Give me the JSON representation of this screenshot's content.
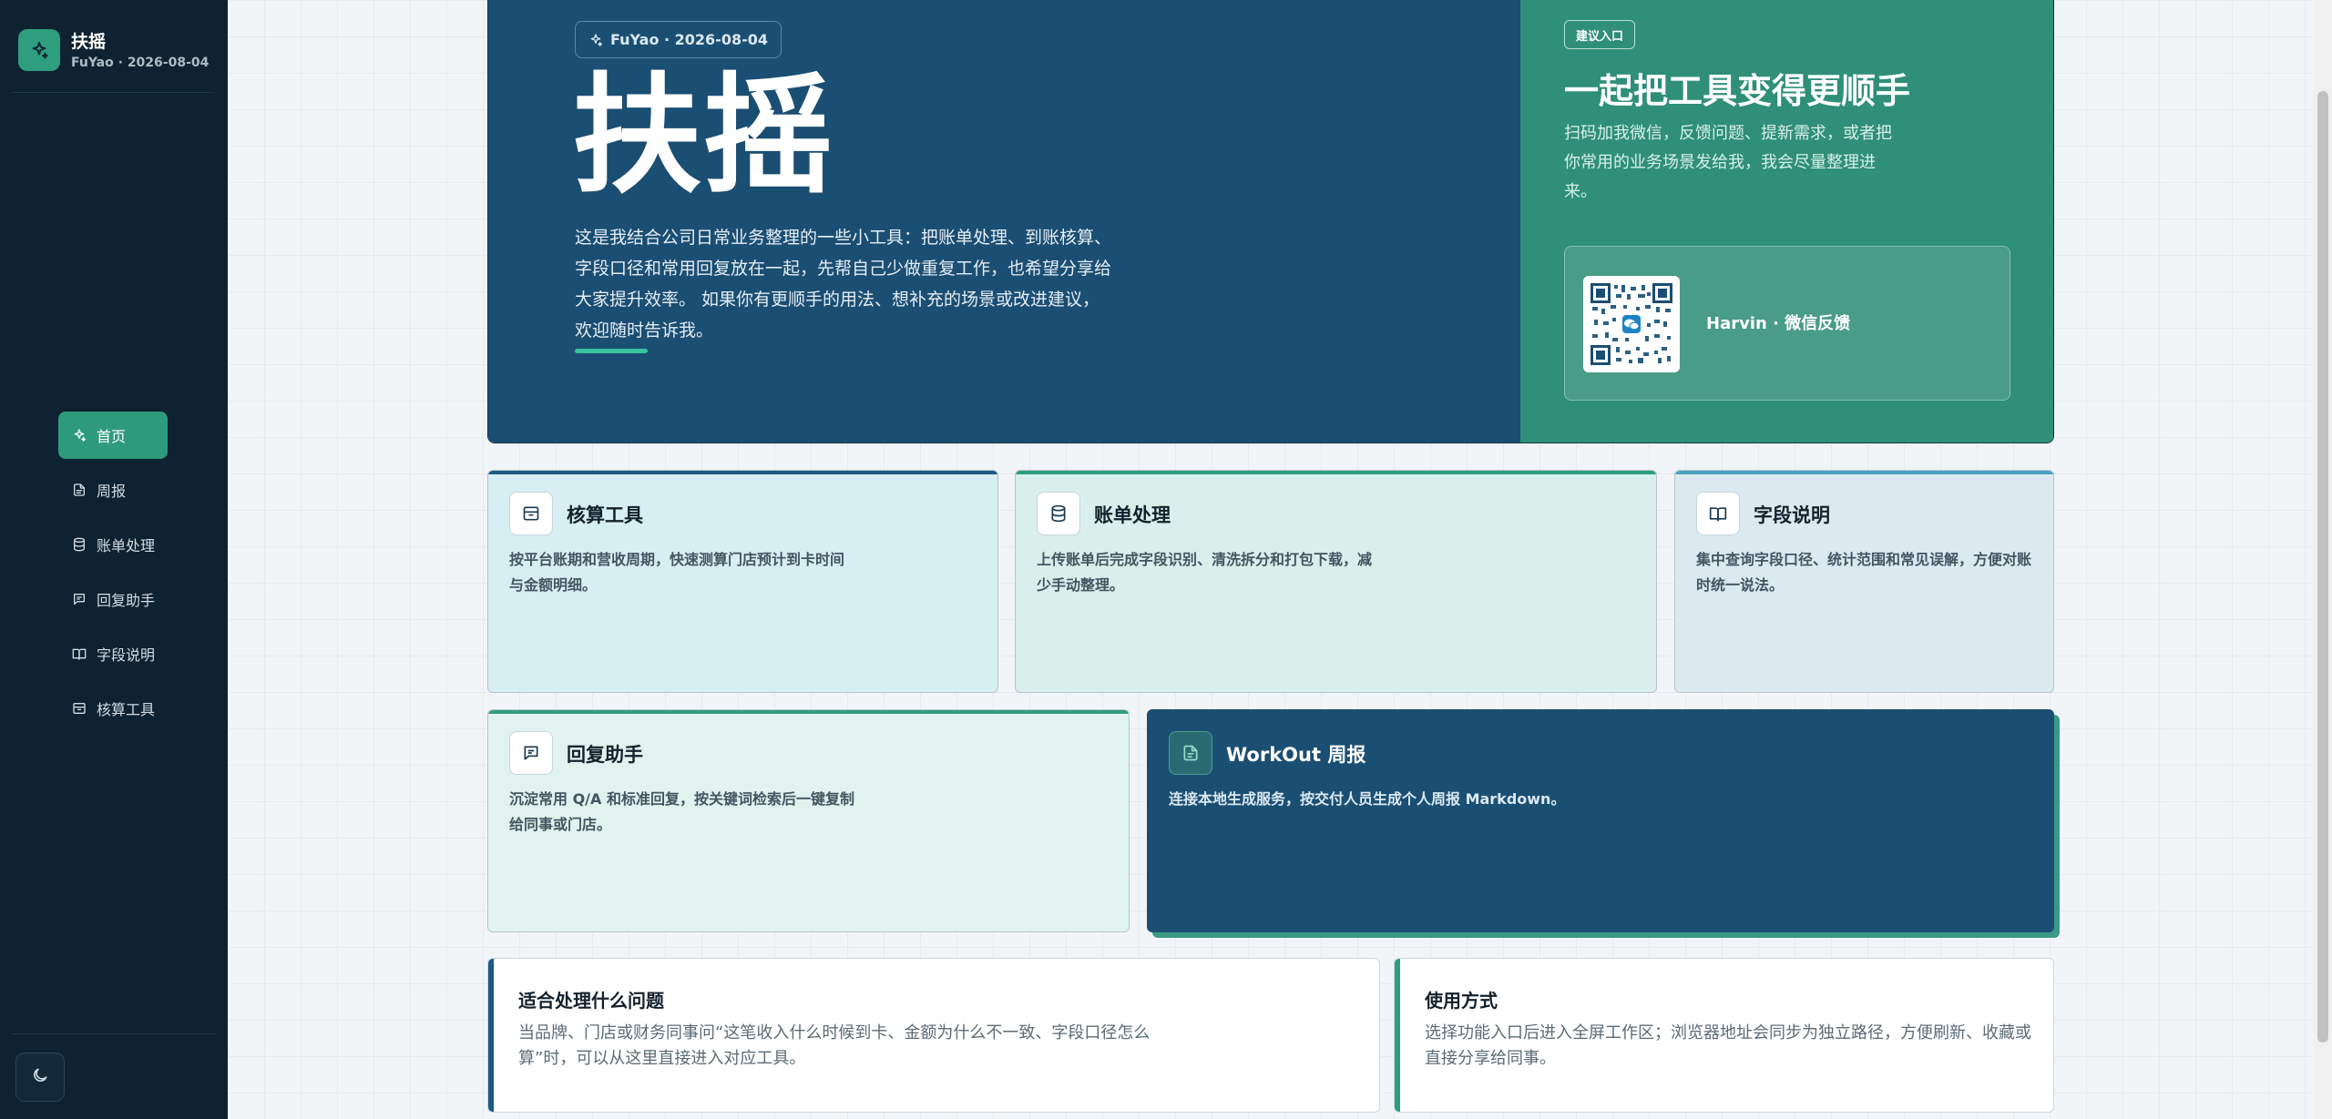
{
  "sidebar": {
    "brand_title": "扶摇",
    "brand_sub": "FuYao · 2026-08-04",
    "items": [
      {
        "label": "首页",
        "icon": "sparkle-icon",
        "active": true
      },
      {
        "label": "周报",
        "icon": "document-icon",
        "active": false
      },
      {
        "label": "账单处理",
        "icon": "database-icon",
        "active": false
      },
      {
        "label": "回复助手",
        "icon": "message-icon",
        "active": false
      },
      {
        "label": "字段说明",
        "icon": "book-icon",
        "active": false
      },
      {
        "label": "核算工具",
        "icon": "inbox-icon",
        "active": false
      }
    ],
    "theme_toggle_icon": "moon-icon"
  },
  "hero": {
    "chip": "FuYao · 2026-08-04",
    "title": "扶摇",
    "desc": "这是我结合公司日常业务整理的一些小工具：把账单处理、到账核算、字段口径和常用回复放在一起，先帮自己少做重复工作，也希望分享给大家提升效率。 如果你有更顺手的用法、想补充的场景或改进建议，欢迎随时告诉我。",
    "suggest_chip": "建议入口",
    "right_title": "一起把工具变得更顺手",
    "right_desc": "扫码加我微信，反馈问题、提新需求，或者把你常用的业务场景发给我，我会尽量整理进来。",
    "qr_label": "Harvin · 微信反馈"
  },
  "cards": [
    {
      "title": "核算工具",
      "desc": "按平台账期和营收周期，快速测算门店预计到卡时间与金额明细。",
      "icon": "inbox-icon",
      "accent": "#1b5a82"
    },
    {
      "title": "账单处理",
      "desc": "上传账单后完成字段识别、清洗拆分和打包下载，减少手动整理。",
      "icon": "database-icon",
      "accent": "#2f9e7e"
    },
    {
      "title": "字段说明",
      "desc": "集中查询字段口径、统计范围和常见误解，方便对账时统一说法。",
      "icon": "book-icon",
      "accent": "#4aa3c0"
    },
    {
      "title": "回复助手",
      "desc": "沉淀常用 Q/A 和标准回复，按关键词检索后一键复制给同事或门店。",
      "icon": "message-icon",
      "accent": "#2f9e7e"
    },
    {
      "title": "WorkOut 周报",
      "desc": "连接本地生成服务，按交付人员生成个人周报 Markdown。",
      "icon": "document-icon",
      "accent": "#3a9a85"
    }
  ],
  "info": [
    {
      "title": "适合处理什么问题",
      "desc": "当品牌、门店或财务同事问“这笔收入什么时候到卡、金额为什么不一致、字段口径怎么算”时，可以从这里直接进入对应工具。",
      "accent": "#1b5a82"
    },
    {
      "title": "使用方式",
      "desc": "选择功能入口后进入全屏工作区；浏览器地址会同步为独立路径，方便刷新、收藏或直接分享给同事。",
      "accent": "#2f9e7e"
    }
  ],
  "colors": {
    "sidebar_bg": "#0f2231",
    "accent_green": "#2f9e7e",
    "hero_blue": "#1b4e73"
  }
}
